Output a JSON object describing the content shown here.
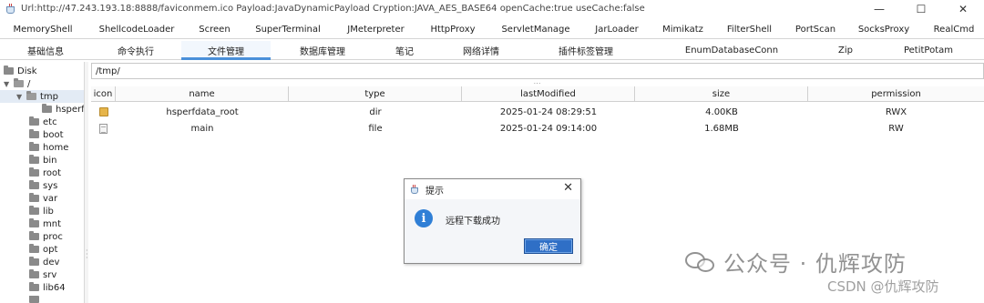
{
  "window": {
    "title": "Url:http://47.243.193.18:8888/faviconmem.ico Payload:JavaDynamicPayload Cryption:JAVA_AES_BASE64 openCache:true useCache:false",
    "minimize": "—",
    "maximize": "☐",
    "close": "✕"
  },
  "tabs_row1": [
    "MemoryShell",
    "ShellcodeLoader",
    "Screen",
    "SuperTerminal",
    "JMeterpreter",
    "HttpProxy",
    "ServletManage",
    "JarLoader",
    "Mimikatz",
    "FilterShell",
    "PortScan",
    "SocksProxy",
    "RealCmd"
  ],
  "tabs_row2": [
    "基础信息",
    "命令执行",
    "文件管理",
    "数据库管理",
    "笔记",
    "网络详情",
    "插件标签管理",
    "EnumDatabaseConn",
    "Zip",
    "PetitPotam"
  ],
  "active_tab": "文件管理",
  "tree": {
    "root": "Disk",
    "slash": "/",
    "selected": "tmp",
    "child": "hsperfc",
    "items": [
      "etc",
      "boot",
      "home",
      "bin",
      "root",
      "sys",
      "var",
      "lib",
      "mnt",
      "proc",
      "opt",
      "dev",
      "srv",
      "lib64"
    ]
  },
  "path": "/tmp/",
  "splitter_grip": "⋯",
  "table": {
    "headers": [
      "icon",
      "name",
      "type",
      "lastModified",
      "size",
      "permission"
    ],
    "rows": [
      {
        "icon": "folder-icon",
        "name": "hsperfdata_root",
        "type": "dir",
        "lastModified": "2025-01-24 08:29:51",
        "size": "4.00KB",
        "permission": "RWX"
      },
      {
        "icon": "file-icon",
        "name": "main",
        "type": "file",
        "lastModified": "2025-01-24 09:14:00",
        "size": "1.68MB",
        "permission": "RW"
      }
    ]
  },
  "dialog": {
    "title": "提示",
    "close": "✕",
    "icon": "i",
    "message": "远程下载成功",
    "ok": "确定"
  },
  "watermark": {
    "main": "公众号 · 仇辉攻防",
    "sub": "CSDN @仇辉攻防"
  },
  "colors": {
    "accent": "#4a90d9",
    "button": "#2f6fc6",
    "info": "#2f7fd6"
  }
}
